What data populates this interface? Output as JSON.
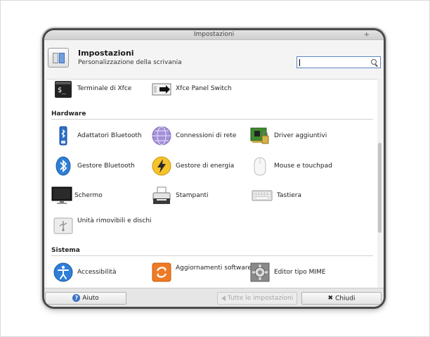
{
  "window": {
    "title": "Impostazioni"
  },
  "header": {
    "title": "Impostazioni",
    "subtitle": "Personalizzazione della scrivania",
    "search_value": ""
  },
  "items_top": [
    {
      "label": "Terminale di Xfce",
      "icon": "terminal-icon"
    },
    {
      "label": "Xfce Panel Switch",
      "icon": "panel-switch-icon"
    }
  ],
  "sections": {
    "hardware": "Hardware",
    "sistema": "Sistema"
  },
  "hardware_items": [
    {
      "label": "Adattatori Bluetooth",
      "icon": "bluetooth-adapter-icon"
    },
    {
      "label": "Connessioni di rete",
      "icon": "network-globe-icon"
    },
    {
      "label": "Driver aggiuntivi",
      "icon": "circuit-board-icon"
    },
    {
      "label": "Gestore Bluetooth",
      "icon": "bluetooth-icon"
    },
    {
      "label": "Gestore di energia",
      "icon": "power-bolt-icon"
    },
    {
      "label": "Mouse e touchpad",
      "icon": "mouse-icon"
    },
    {
      "label": "Schermo",
      "icon": "monitor-icon"
    },
    {
      "label": "Stampanti",
      "icon": "printer-icon"
    },
    {
      "label": "Tastiera",
      "icon": "keyboard-icon"
    },
    {
      "label": "Unità rimovibili e dischi",
      "icon": "usb-drive-icon"
    }
  ],
  "sistema_items": [
    {
      "label": "Accessibilità",
      "icon": "accessibility-icon"
    },
    {
      "label": "Aggiornamenti software",
      "icon": "software-update-icon"
    },
    {
      "label": "Editor tipo MIME",
      "icon": "mime-gear-icon"
    }
  ],
  "buttons": {
    "help": "Aiuto",
    "all_settings": "Tutte le impostazioni",
    "close": "Chiudi"
  }
}
